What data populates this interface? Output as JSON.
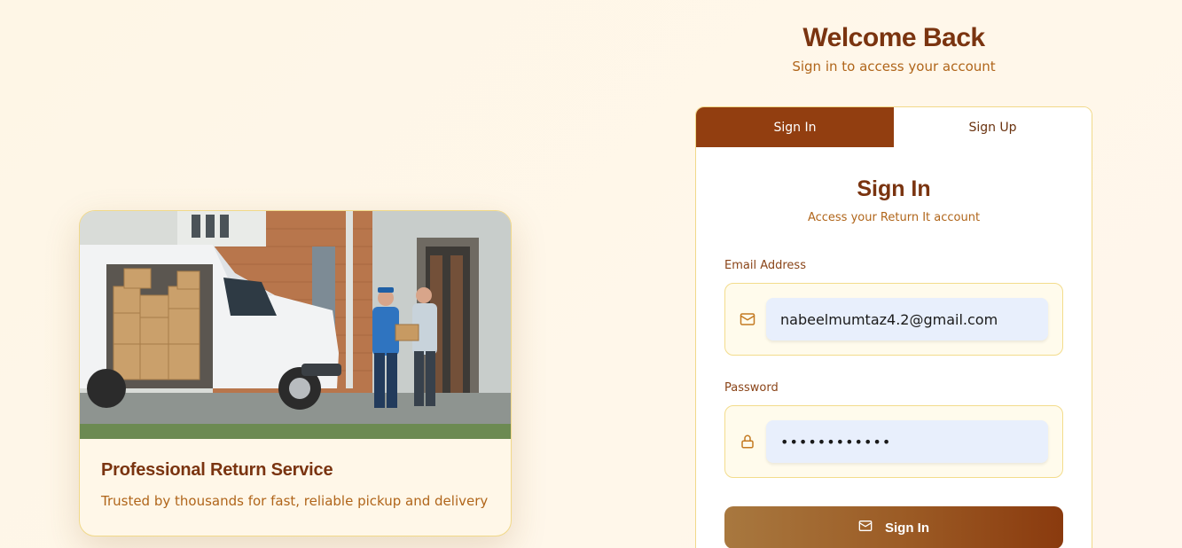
{
  "header": {
    "title": "Welcome Back",
    "subtitle": "Sign in to access your account"
  },
  "promo": {
    "image_alt": "delivery-van-photo",
    "title": "Professional Return Service",
    "subtitle": "Trusted by thousands for fast, reliable pickup and delivery"
  },
  "tabs": [
    {
      "label": "Sign In",
      "active": true
    },
    {
      "label": "Sign Up",
      "active": false
    }
  ],
  "form": {
    "title": "Sign In",
    "subtitle": "Access your Return It account",
    "email": {
      "label": "Email Address",
      "value": "nabeelmumtaz4.2@gmail.com",
      "icon": "mail-icon"
    },
    "password": {
      "label": "Password",
      "value": "••••••••••••",
      "icon": "lock-icon"
    },
    "submit": {
      "label": "Sign In",
      "icon": "mail-icon"
    }
  },
  "colors": {
    "accent": "#923e10",
    "brand_text": "#7a3410",
    "muted_text": "#b0651a",
    "border": "#f1d98a",
    "input_bg": "#e8effc"
  }
}
